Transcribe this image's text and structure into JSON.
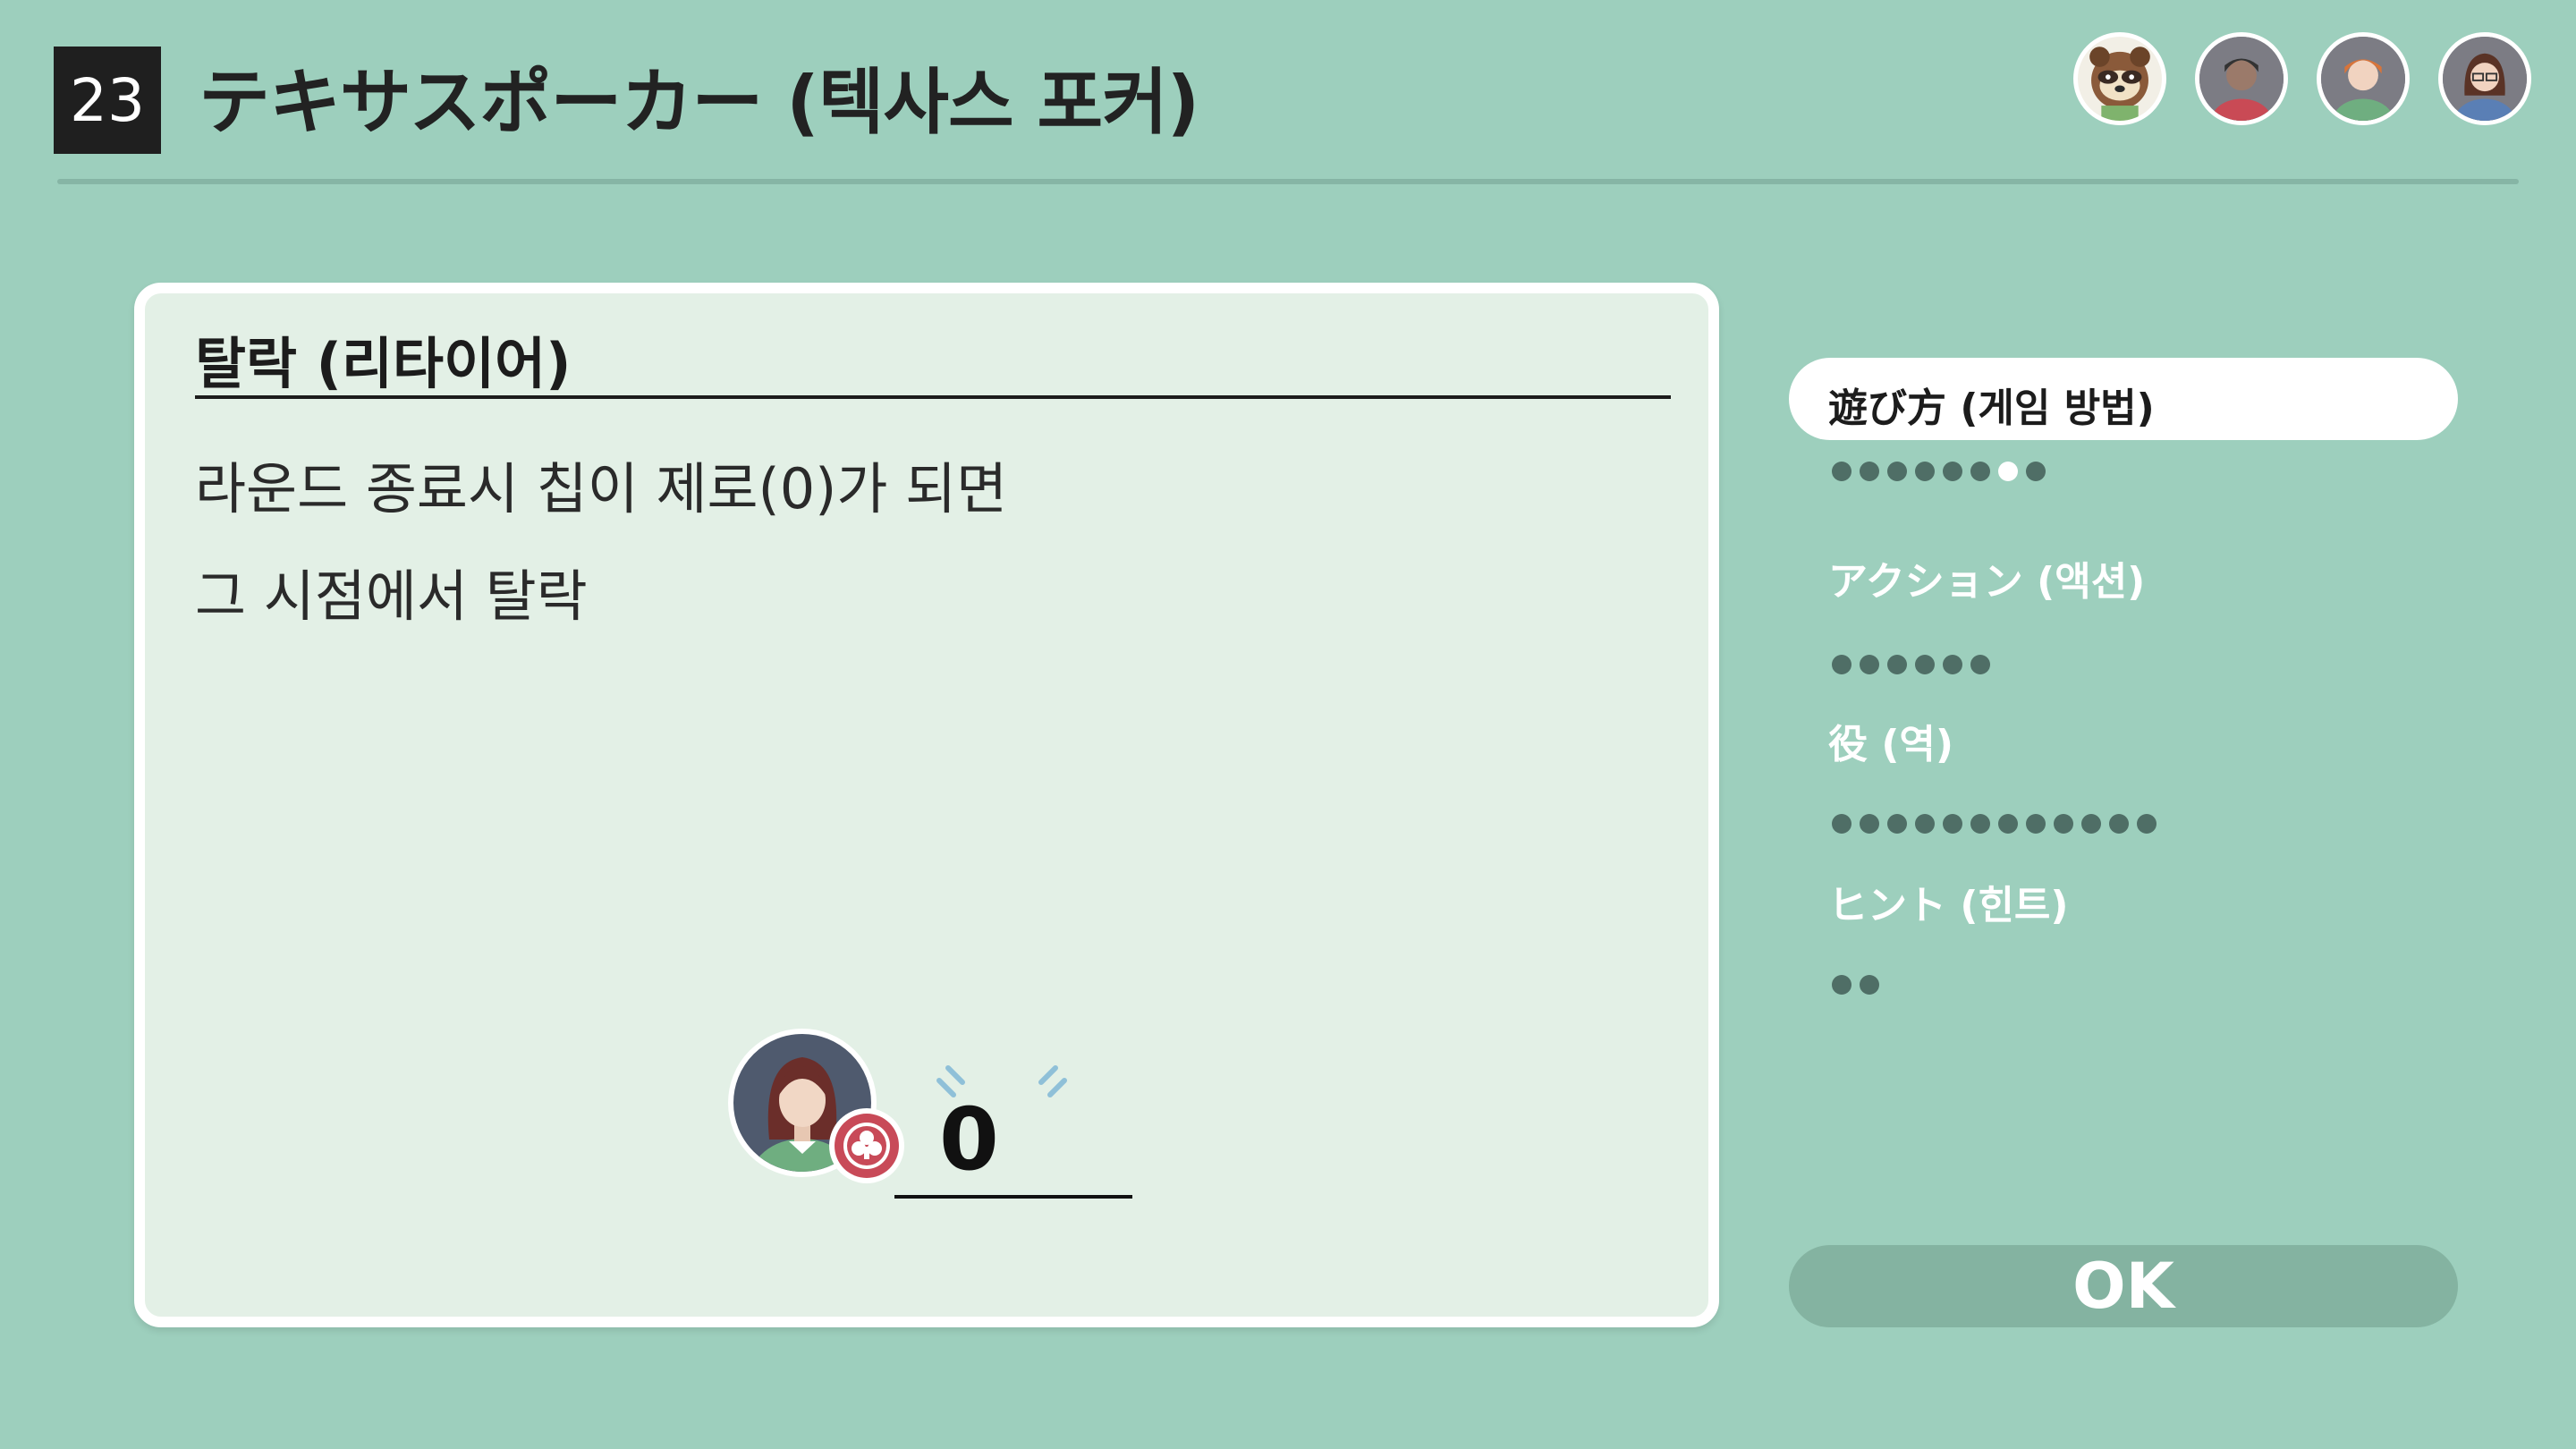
{
  "header": {
    "game_number": "23",
    "title": "テキサスポーカー (텍사스 포커)",
    "avatars": [
      {
        "name": "raccoon-character",
        "icon": "raccoon-avatar-icon"
      },
      {
        "name": "player-dark-hair",
        "icon": "person-avatar-icon"
      },
      {
        "name": "player-orange-hair",
        "icon": "person-avatar-icon"
      },
      {
        "name": "player-glasses",
        "icon": "person-avatar-icon"
      }
    ]
  },
  "content": {
    "heading": "탈락 (리타이어)",
    "lines": [
      "라운드 종료시 칩이 제로(0)가 되면",
      "그 시점에서 탈락"
    ],
    "illustration": {
      "chip_count": "0",
      "chip_icon": "club-chip-icon"
    }
  },
  "menu": {
    "items": [
      {
        "label": "遊び方 (게임 방법)",
        "active": true,
        "pages": 8,
        "current_page": 7
      },
      {
        "label": "アクション (액션)",
        "active": false,
        "pages": 6,
        "current_page": null
      },
      {
        "label": "役 (역)",
        "active": false,
        "pages": 12,
        "current_page": null
      },
      {
        "label": "ヒント (힌트)",
        "active": false,
        "pages": 2,
        "current_page": null
      }
    ]
  },
  "ok_button": {
    "label": "OK"
  },
  "colors": {
    "background": "#9dcfbd",
    "panel": "#e3f0e6",
    "dot": "#4f6e66",
    "ok_button": "#84b3a1"
  }
}
